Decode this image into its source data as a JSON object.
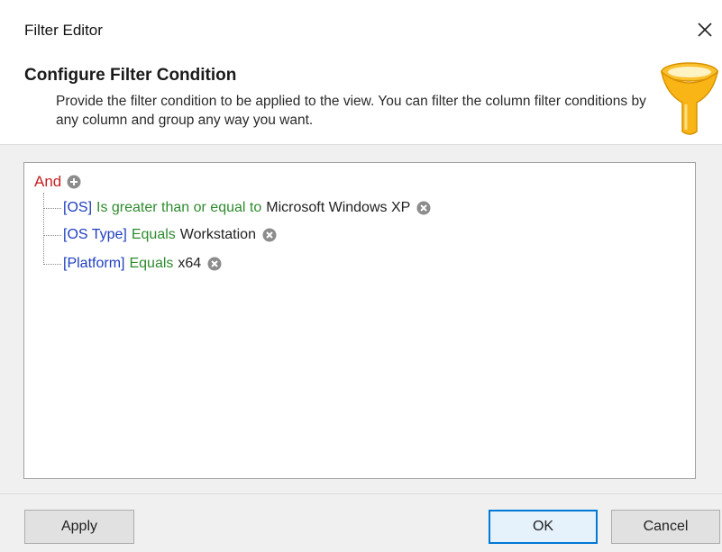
{
  "window": {
    "title": "Filter Editor",
    "close_icon": "close-icon"
  },
  "header": {
    "title": "Configure Filter Condition",
    "description": "Provide the filter condition to be applied to the view. You can filter the column filter conditions by any column and group any way you want.",
    "icon": "funnel-icon"
  },
  "editor": {
    "group_operator": "And",
    "add_icon": "plus-circle-icon",
    "conditions": [
      {
        "field": "[OS]",
        "operator": "Is greater than or equal to",
        "value": "Microsoft Windows XP",
        "remove_icon": "remove-circle-icon"
      },
      {
        "field": "[OS Type]",
        "operator": "Equals",
        "value": "Workstation",
        "remove_icon": "remove-circle-icon"
      },
      {
        "field": "[Platform]",
        "operator": "Equals",
        "value": "x64",
        "remove_icon": "remove-circle-icon"
      }
    ]
  },
  "footer": {
    "apply_label": "Apply",
    "ok_label": "OK",
    "cancel_label": "Cancel"
  },
  "colors": {
    "group_operator": "#c42121",
    "field": "#1f3fbf",
    "operator": "#2e8b2e",
    "accent": "#0078d7",
    "funnel": "#f4b400"
  }
}
